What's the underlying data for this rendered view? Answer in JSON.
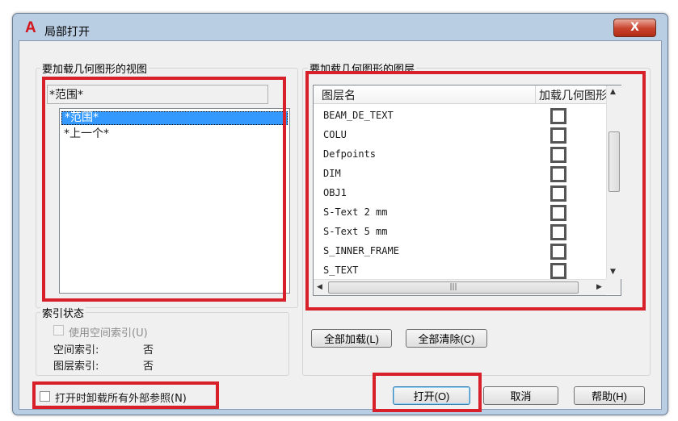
{
  "window": {
    "title": "局部打开",
    "app_icon": "autocad-icon",
    "close_label": "X"
  },
  "views_group": {
    "label": "要加载几何图形的视图",
    "combo_value": "*范围*",
    "items": [
      {
        "label": "*范围*",
        "selected": true
      },
      {
        "label": "*上一个*",
        "selected": false
      }
    ]
  },
  "layers_group": {
    "label": "要加载几何图形的图层",
    "columns": [
      "图层名",
      "加载几何图形"
    ],
    "rows": [
      {
        "name": "BEAM_DE_TEXT",
        "load": false
      },
      {
        "name": "COLU",
        "load": false
      },
      {
        "name": "Defpoints",
        "load": false
      },
      {
        "name": "DIM",
        "load": false
      },
      {
        "name": "OBJ1",
        "load": false
      },
      {
        "name": "S-Text 2 mm",
        "load": false
      },
      {
        "name": "S-Text 5 mm",
        "load": false
      },
      {
        "name": "S_INNER_FRAME",
        "load": false
      },
      {
        "name": "S_TEXT",
        "load": false
      }
    ],
    "load_all_label": "全部加载(L)",
    "clear_all_label": "全部清除(C)"
  },
  "index_group": {
    "label": "索引状态",
    "use_spatial_label": "使用空间索引(U)",
    "use_spatial_checked": false,
    "spatial_label": "空间索引:",
    "spatial_value": "否",
    "layer_label": "图层索引:",
    "layer_value": "否"
  },
  "unload_xrefs": {
    "label": "打开时卸载所有外部参照(N)",
    "checked": false
  },
  "buttons": {
    "open": "打开(O)",
    "cancel": "取消",
    "help": "帮助(H)"
  },
  "colors": {
    "highlight_frame": "#d8202a",
    "selection": "#3399ff",
    "title_bg": "#b9cde3",
    "close_button": "#c8412b"
  }
}
